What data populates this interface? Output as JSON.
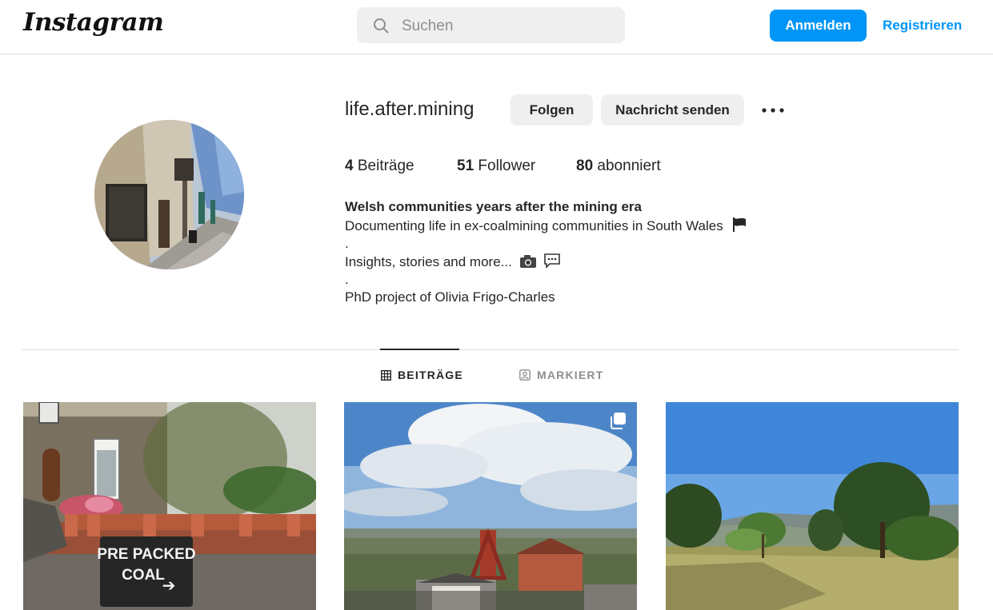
{
  "header": {
    "logo_text": "Instagram",
    "search_placeholder": "Suchen",
    "login_label": "Anmelden",
    "register_label": "Registrieren"
  },
  "profile": {
    "username": "life.after.mining",
    "follow_label": "Folgen",
    "message_label": "Nachricht senden",
    "posts_count": "4",
    "posts_label": "Beiträge",
    "followers_count": "51",
    "followers_label": "Follower",
    "following_count": "80",
    "following_label": "abonniert",
    "bio": {
      "title": "Welsh communities years after the mining era",
      "line1": "Documenting life in ex-coalmining communities in South Wales",
      "sep1": ".",
      "line2": "Insights, stories and more...",
      "sep2": ".",
      "line3": "PhD project of Olivia Frigo-Charles"
    }
  },
  "tabs": [
    {
      "label": "BEITRÄGE",
      "active": true
    },
    {
      "label": "MARKIERT",
      "active": false
    }
  ],
  "posts": [
    {
      "sign_line1": "PRE PACKED",
      "sign_line2": "COAL",
      "sign_arrow": "➔"
    },
    {
      "multi_image": true
    },
    {
      "multi_image": false
    }
  ],
  "colors": {
    "accent": "#0095f6",
    "button_gray": "#efefef",
    "border": "#dbdbdb",
    "text": "#262626",
    "muted": "#8e8e8e"
  },
  "icons": [
    "search-icon",
    "more-icon",
    "grid-icon",
    "tagged-icon",
    "flag-icon",
    "camera-icon",
    "speech-bubble-icon",
    "multi-image-icon"
  ]
}
